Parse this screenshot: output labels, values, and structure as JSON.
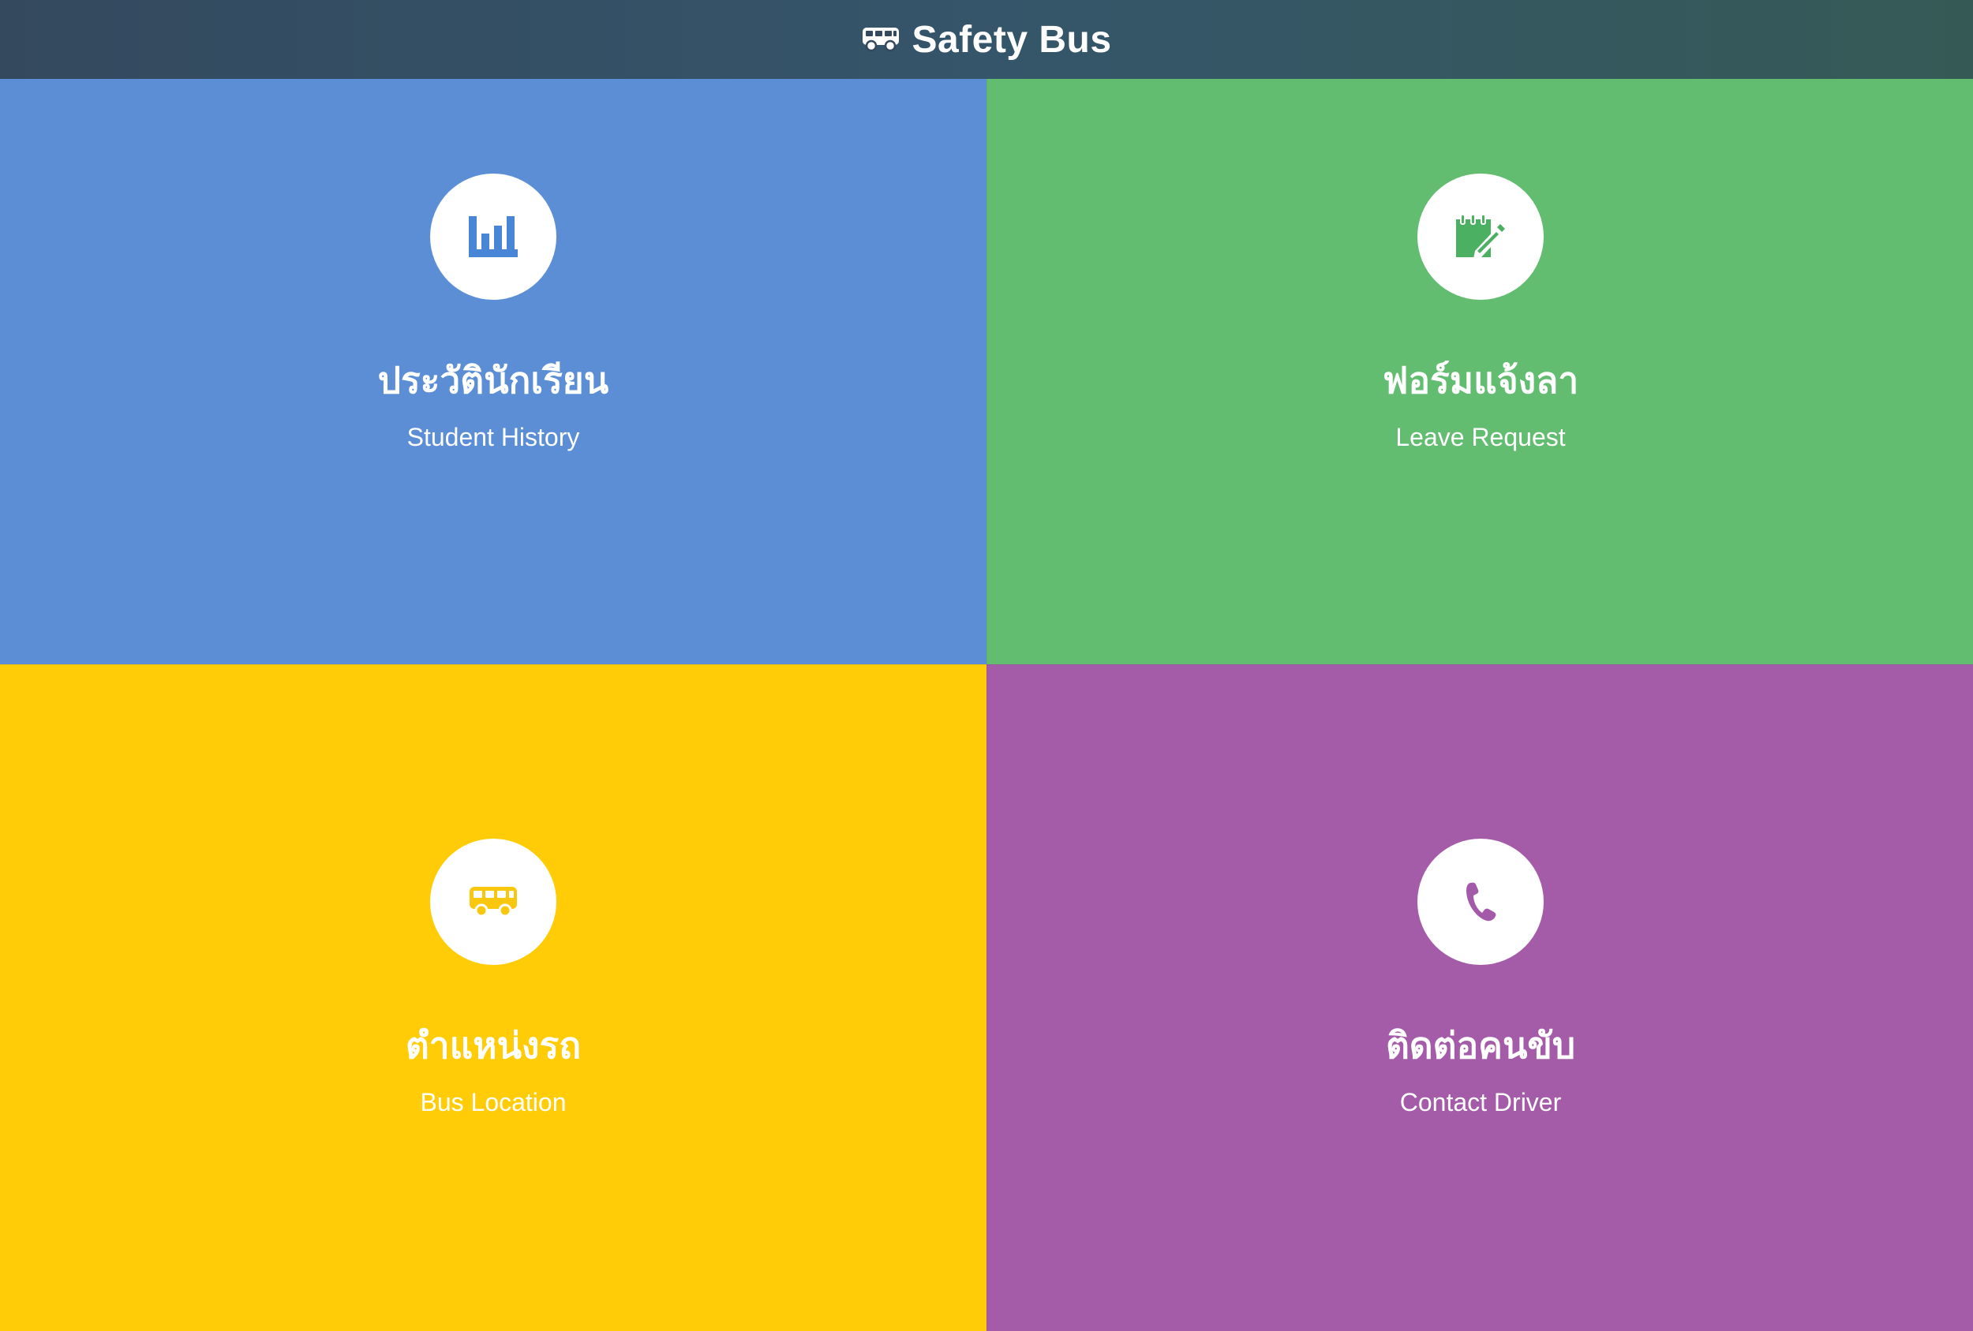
{
  "header": {
    "title": "Safety Bus",
    "icon": "bus-icon"
  },
  "tiles": [
    {
      "thai": "ประวัตินักเรียน",
      "english": "Student History",
      "icon": "bar-chart-icon",
      "color": "#5b8ed4",
      "icon_color": "#4a86d8"
    },
    {
      "thai": "ฟอร์มแจ้งลา",
      "english": "Leave Request",
      "icon": "edit-note-icon",
      "color": "#63bd70",
      "icon_color": "#4cb063"
    },
    {
      "thai": "ตำแหน่งรถ",
      "english": "Bus Location",
      "icon": "bus-icon",
      "color": "#ffcc07",
      "icon_color": "#f9c80e"
    },
    {
      "thai": "ติดต่อคนขับ",
      "english": "Contact Driver",
      "icon": "phone-icon",
      "color": "#a45ba8",
      "icon_color": "#a35aa8"
    }
  ]
}
